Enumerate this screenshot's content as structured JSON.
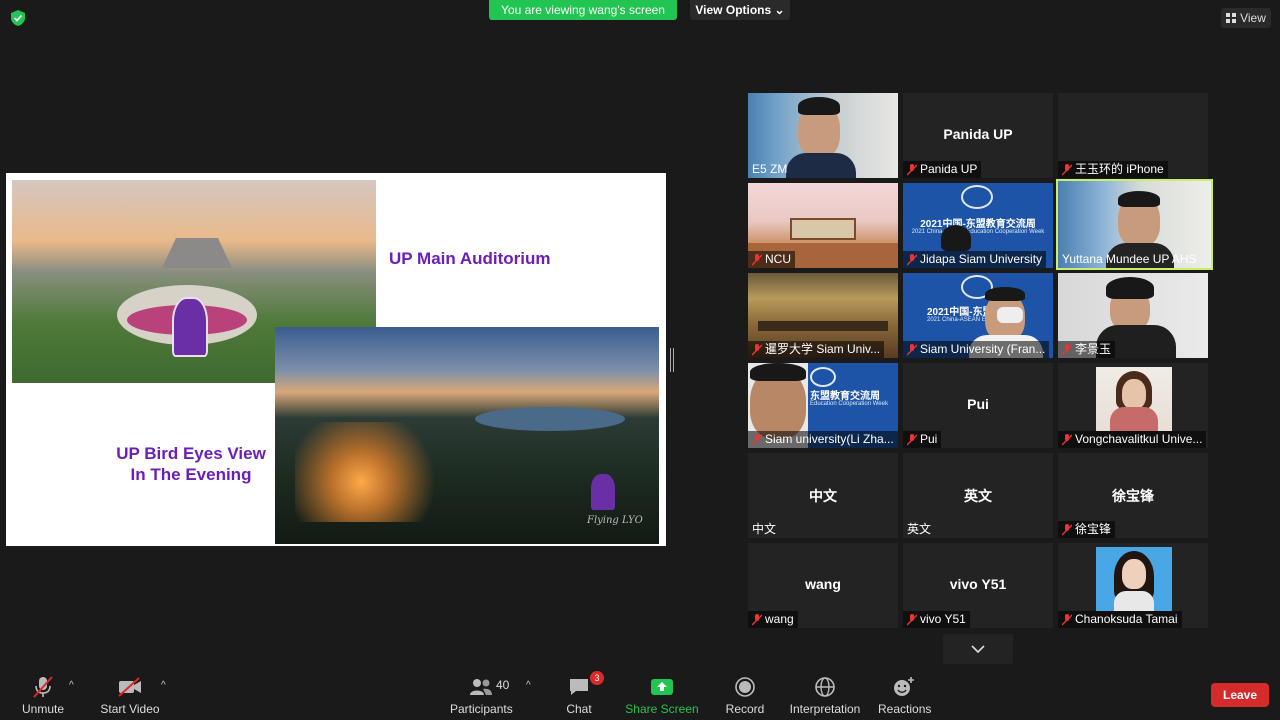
{
  "top_bar": {
    "banner": "You are viewing wang's screen",
    "view_options": "View Options",
    "view": "View"
  },
  "slide": {
    "title_top": "UP Main Auditorium",
    "title_bottom_line1": "UP Bird Eyes View",
    "title_bottom_line2": "In The Evening",
    "logo_text": "Flying LYO"
  },
  "gallery": [
    {
      "name": "",
      "label": "E5 ZM",
      "muted": false
    },
    {
      "name": "Panida UP",
      "label": "Panida UP",
      "muted": true
    },
    {
      "name": "",
      "label": "王玉环的 iPhone",
      "muted": true
    },
    {
      "name": "",
      "label": "NCU",
      "muted": true
    },
    {
      "name": "",
      "label": "Jidapa Siam University",
      "muted": true
    },
    {
      "name": "",
      "label": "Yuttana Mundee UP AHS",
      "muted": false
    },
    {
      "name": "",
      "label": "暹罗大学 Siam Univ...",
      "muted": true
    },
    {
      "name": "",
      "label": "Siam University (Fran...",
      "muted": true
    },
    {
      "name": "",
      "label": "李景玉",
      "muted": true
    },
    {
      "name": "",
      "label": "Siam university(Li Zha...",
      "muted": true
    },
    {
      "name": "Pui",
      "label": "Pui",
      "muted": true
    },
    {
      "name": "",
      "label": "Vongchavalitkul Unive...",
      "muted": true
    },
    {
      "name": "中文",
      "label": "中文",
      "muted": false
    },
    {
      "name": "英文",
      "label": "英文",
      "muted": false
    },
    {
      "name": "徐宝锋",
      "label": "徐宝锋",
      "muted": true
    },
    {
      "name": "wang",
      "label": "wang",
      "muted": true
    },
    {
      "name": "vivo Y51",
      "label": "vivo Y51",
      "muted": true
    },
    {
      "name": "",
      "label": "Chanoksuda Tamai",
      "muted": true
    }
  ],
  "gallery_banners": {
    "edu_week_cn": "2021中国-东盟教育交流周",
    "edu_week_en": "2021 China-ASEAN Education Cooperation Week",
    "edu_week_cn_short": "东盟教育交流周",
    "edu_week_en_short": "Education Cooperation Week",
    "edu_week_cn_partial": "2021中国-东盟教",
    "edu_week_en_partial": "2021 China-ASEAN Education"
  },
  "toolbar": {
    "unmute": "Unmute",
    "start_video": "Start Video",
    "participants": "Participants",
    "participants_count": "40",
    "chat": "Chat",
    "chat_badge": "3",
    "share_screen": "Share Screen",
    "record": "Record",
    "interpretation": "Interpretation",
    "reactions": "Reactions",
    "leave": "Leave"
  },
  "colors": {
    "banner_green": "#23c552",
    "share_green": "#23c552",
    "leave_red": "#d52b2b",
    "active_speaker": "#c9f06a",
    "slide_title": "#6b1fb8"
  }
}
